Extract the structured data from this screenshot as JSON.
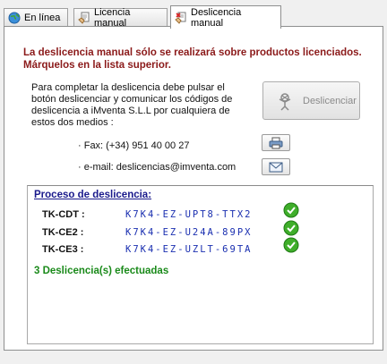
{
  "tabs": [
    {
      "label": "En línea",
      "icon": "globe-icon"
    },
    {
      "label": "Licencia manual",
      "icon": "hand-document-icon"
    },
    {
      "label": "Deslicencia manual",
      "icon": "unlicense-icon"
    }
  ],
  "warning": "La deslicencia manual sólo se realizará sobre productos licenciados. Márquelos en la lista superior.",
  "instructions": "Para completar la deslicencia debe pulsar el botón deslicenciar y comunicar los códigos de deslicencia a iMventa S.L.L por cualquiera de estos dos medios :",
  "unlicense_button": {
    "label": "Deslicenciar",
    "icon": "unlicense-figure-icon",
    "enabled": false
  },
  "contact": {
    "fax": "· Fax: (+34) 951 40 00 27",
    "fax_icon": "printer-icon",
    "email": "· e-mail: deslicencias@imventa.com",
    "email_icon": "email-icon"
  },
  "process": {
    "title": "Proceso de deslicencia:",
    "rows": [
      {
        "label": "TK-CDT :",
        "code": "K7K4-EZ-UPT8-TTX2",
        "status": "ok"
      },
      {
        "label": "TK-CE2 :",
        "code": "K7K4-EZ-U24A-89PX",
        "status": "ok"
      },
      {
        "label": "TK-CE3 :",
        "code": "K7K4-EZ-UZLT-69TA",
        "status": "ok"
      }
    ],
    "result": "3 Deslicencia(s) efectuadas"
  },
  "colors": {
    "warning": "#8b1a1a",
    "title": "#1a1a8c",
    "code": "#1a2fb0",
    "success": "#1a8a1a"
  }
}
